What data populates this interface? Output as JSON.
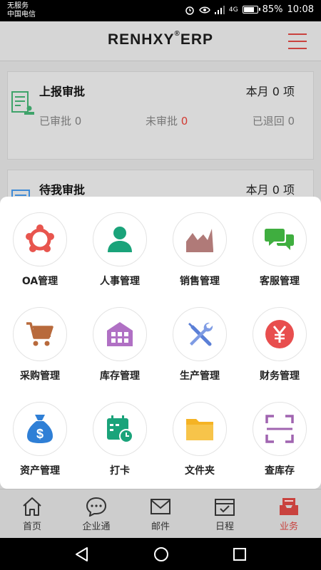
{
  "status_bar": {
    "carrier_line1": "无服务",
    "carrier_line2": "中国电信",
    "battery": "85%",
    "battery_level": 0.85,
    "time": "10:08",
    "network": "4G"
  },
  "header": {
    "logo_text": "RENHXY",
    "logo_mark": "®",
    "logo_suffix": "ERP",
    "menu_icon": "hamburger-icon",
    "accent_color": "#c9423e"
  },
  "cards": [
    {
      "title": "上报审批",
      "month_label": "本月 0 项",
      "stats": [
        "已审批 0",
        "未审批",
        "已退回 0"
      ],
      "pending_count": "0",
      "icon": "report-approval-icon"
    },
    {
      "title": "待我审批",
      "month_label": "本月 0 项",
      "icon": "pending-approval-icon"
    }
  ],
  "modules": [
    {
      "label": "OA管理",
      "icon": "oa-icon",
      "color": "#e8554e"
    },
    {
      "label": "人事管理",
      "icon": "person-icon",
      "color": "#1aa37a"
    },
    {
      "label": "销售管理",
      "icon": "sales-chart-icon",
      "color": "#b07a78"
    },
    {
      "label": "客服管理",
      "icon": "chat-bubbles-icon",
      "color": "#3fae3f"
    },
    {
      "label": "采购管理",
      "icon": "shopping-cart-icon",
      "color": "#b86a3c"
    },
    {
      "label": "库存管理",
      "icon": "warehouse-icon",
      "color": "#b070c4"
    },
    {
      "label": "生产管理",
      "icon": "tools-icon",
      "color": "#5b7fd6"
    },
    {
      "label": "财务管理",
      "icon": "yen-icon",
      "color": "#e84e4e"
    },
    {
      "label": "资产管理",
      "icon": "money-bag-icon",
      "color": "#2f7fd6"
    },
    {
      "label": "打卡",
      "icon": "calendar-clock-icon",
      "color": "#1aa37a"
    },
    {
      "label": "文件夹",
      "icon": "folder-icon",
      "color": "#f5b324"
    },
    {
      "label": "查库存",
      "icon": "scan-icon",
      "color": "#a064b0"
    }
  ],
  "tabs": [
    {
      "label": "首页",
      "icon": "home-icon"
    },
    {
      "label": "企业通",
      "icon": "chat-icon"
    },
    {
      "label": "邮件",
      "icon": "mail-icon"
    },
    {
      "label": "日程",
      "icon": "calendar-check-icon"
    },
    {
      "label": "业务",
      "icon": "business-inbox-icon",
      "active": true
    }
  ]
}
